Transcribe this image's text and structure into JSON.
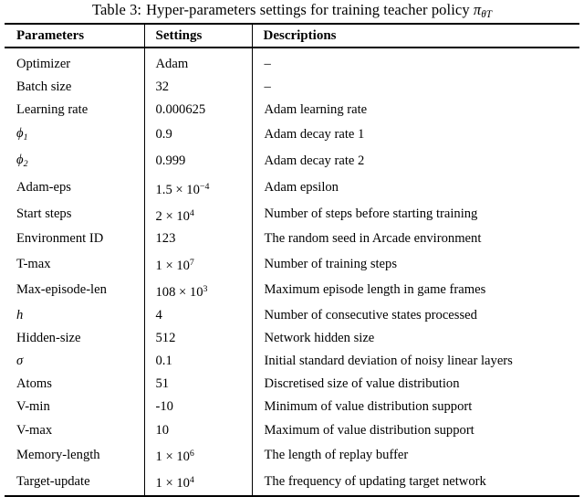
{
  "caption": {
    "label": "Table 3:",
    "text": "Hyper-parameters settings for training teacher policy",
    "symbol": "π",
    "symbol_subscript": "θT"
  },
  "table": {
    "headers": [
      "Parameters",
      "Settings",
      "Descriptions"
    ],
    "rows": [
      {
        "parameter": "Optimizer",
        "parameter_style": "text",
        "setting": "Adam",
        "setting_style": "plain",
        "description": "–"
      },
      {
        "parameter": "Batch size",
        "parameter_style": "text",
        "setting": "32",
        "setting_style": "plain",
        "description": "–"
      },
      {
        "parameter": "Learning rate",
        "parameter_style": "text",
        "setting": "0.000625",
        "setting_style": "plain",
        "description": "Adam learning rate"
      },
      {
        "parameter": "ϕ",
        "parameter_style": "math-sub",
        "parameter_subscript": "1",
        "setting": "0.9",
        "setting_style": "plain",
        "description": "Adam decay rate 1"
      },
      {
        "parameter": "ϕ",
        "parameter_style": "math-sub",
        "parameter_subscript": "2",
        "setting": "0.999",
        "setting_style": "plain",
        "description": "Adam decay rate 2"
      },
      {
        "parameter": "Adam-eps",
        "parameter_style": "text",
        "setting": "1.5",
        "setting_style": "sci",
        "setting_mantissa": "1.5",
        "setting_base": "10",
        "setting_exponent": "−4",
        "description": "Adam epsilon"
      },
      {
        "parameter": "Start steps",
        "parameter_style": "text",
        "setting": "2",
        "setting_style": "sci",
        "setting_mantissa": "2",
        "setting_base": "10",
        "setting_exponent": "4",
        "description": "Number of steps before starting training"
      },
      {
        "parameter": "Environment ID",
        "parameter_style": "text",
        "setting": "123",
        "setting_style": "plain",
        "description": "The random seed in Arcade environment"
      },
      {
        "parameter": "T-max",
        "parameter_style": "text",
        "setting": "1",
        "setting_style": "sci",
        "setting_mantissa": "1",
        "setting_base": "10",
        "setting_exponent": "7",
        "description": "Number of training steps"
      },
      {
        "parameter": "Max-episode-len",
        "parameter_style": "text",
        "setting": "108",
        "setting_style": "sci",
        "setting_mantissa": "108",
        "setting_base": "10",
        "setting_exponent": "3",
        "description": "Maximum episode length in game frames"
      },
      {
        "parameter": "h",
        "parameter_style": "math",
        "setting": "4",
        "setting_style": "plain",
        "description": "Number of consecutive states processed"
      },
      {
        "parameter": "Hidden-size",
        "parameter_style": "text",
        "setting": "512",
        "setting_style": "plain",
        "description": "Network hidden size"
      },
      {
        "parameter": "σ",
        "parameter_style": "math",
        "setting": "0.1",
        "setting_style": "plain",
        "description": "Initial standard deviation of noisy linear layers"
      },
      {
        "parameter": "Atoms",
        "parameter_style": "text",
        "setting": "51",
        "setting_style": "plain",
        "description": "Discretised size of value distribution"
      },
      {
        "parameter": "V-min",
        "parameter_style": "text",
        "setting": "-10",
        "setting_style": "plain",
        "description": "Minimum of value distribution support"
      },
      {
        "parameter": "V-max",
        "parameter_style": "text",
        "setting": "10",
        "setting_style": "plain",
        "description": "Maximum of value distribution support"
      },
      {
        "parameter": "Memory-length",
        "parameter_style": "text",
        "setting": "1",
        "setting_style": "sci",
        "setting_mantissa": "1",
        "setting_base": "10",
        "setting_exponent": "6",
        "description": "The length of replay buffer"
      },
      {
        "parameter": "Target-update",
        "parameter_style": "text",
        "setting": "1",
        "setting_style": "sci",
        "setting_mantissa": "1",
        "setting_base": "10",
        "setting_exponent": "4",
        "description": "The frequency of updating target network"
      }
    ]
  }
}
